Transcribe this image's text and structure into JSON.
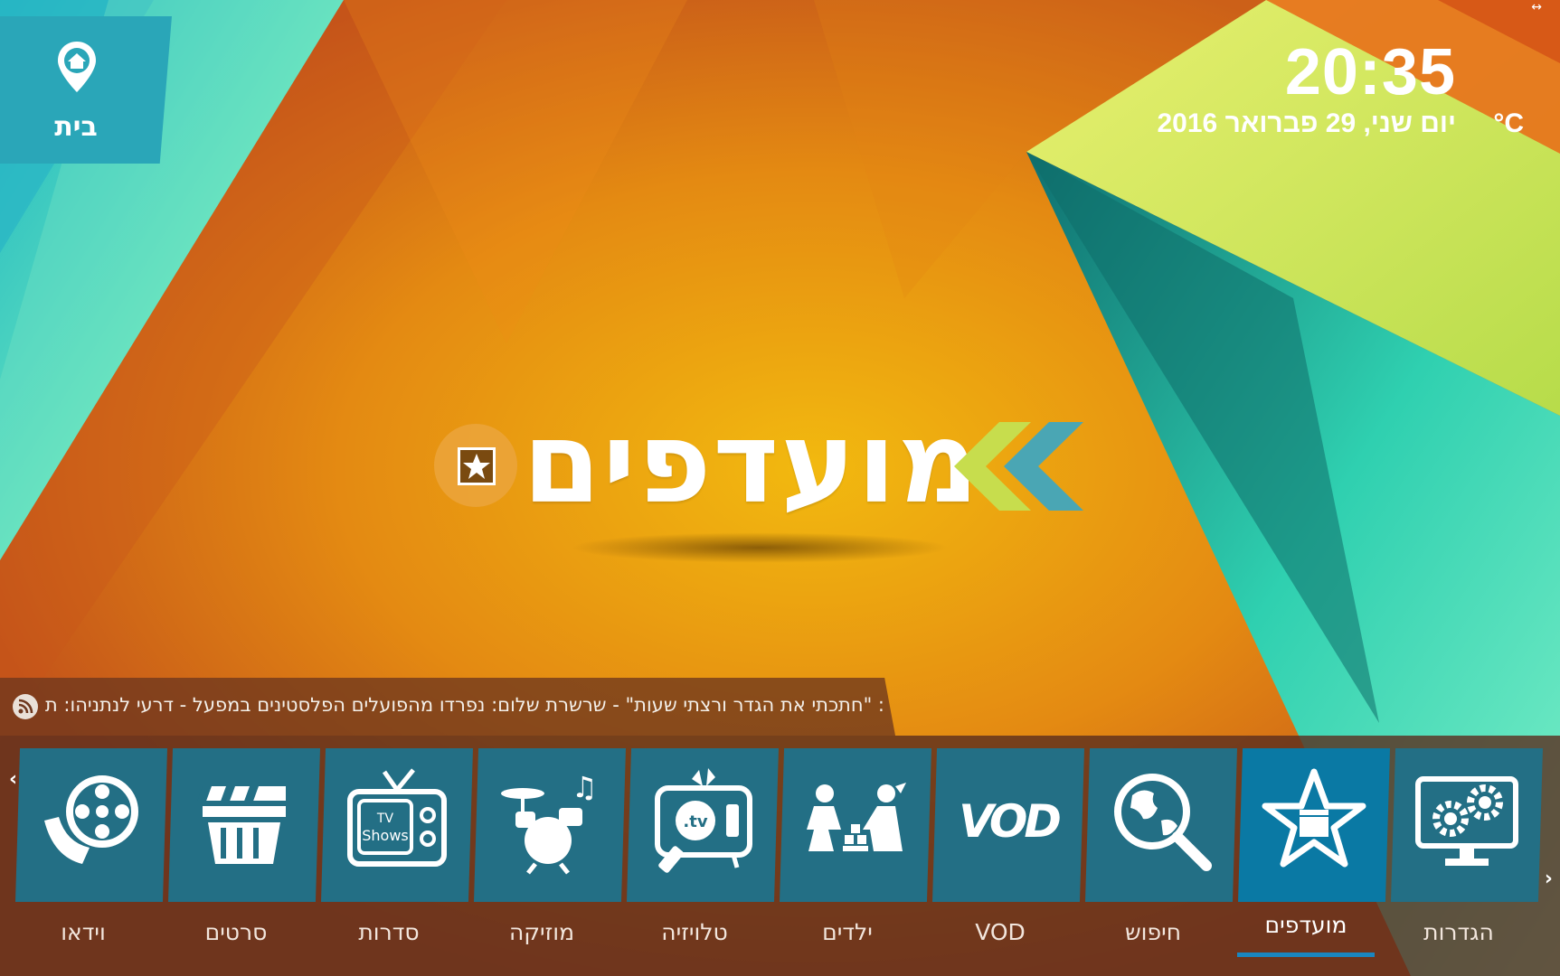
{
  "home": {
    "label": "בית"
  },
  "clock": {
    "time": "20:35",
    "date": "יום שני, 29 פברואר 2016",
    "temperature": "°C"
  },
  "center": {
    "title": "מועדפים"
  },
  "ticker": {
    "text": ": \"חתכתי את הגדר ורצתי שעות\" - שרשרת שלום: נפרדו מהפועלים הפלסטינים במפעל - דרעי לנתניהו: תנאי \"ע"
  },
  "menu": {
    "items": [
      {
        "label": "וידאו",
        "icon": "film-reel-icon"
      },
      {
        "label": "סרטים",
        "icon": "clapperboard-icon"
      },
      {
        "label": "סדרות",
        "icon": "tv-shows-icon"
      },
      {
        "label": "מוזיקה",
        "icon": "drums-icon"
      },
      {
        "label": "טלויזיה",
        "icon": "tv-remote-icon"
      },
      {
        "label": "ילדים",
        "icon": "kids-icon"
      },
      {
        "label": "VOD",
        "icon": "vod-icon"
      },
      {
        "label": "חיפוש",
        "icon": "globe-search-icon"
      },
      {
        "label": "מועדפים",
        "icon": "star-clapper-icon",
        "selected": true
      },
      {
        "label": "הגדרות",
        "icon": "settings-monitor-icon"
      }
    ]
  },
  "colors": {
    "background": "#d9701a",
    "tile": "#236f85",
    "tile_active": "#0a79a4",
    "accent_underline": "#1a86c0",
    "menu_bar": "#5a2d1e"
  }
}
